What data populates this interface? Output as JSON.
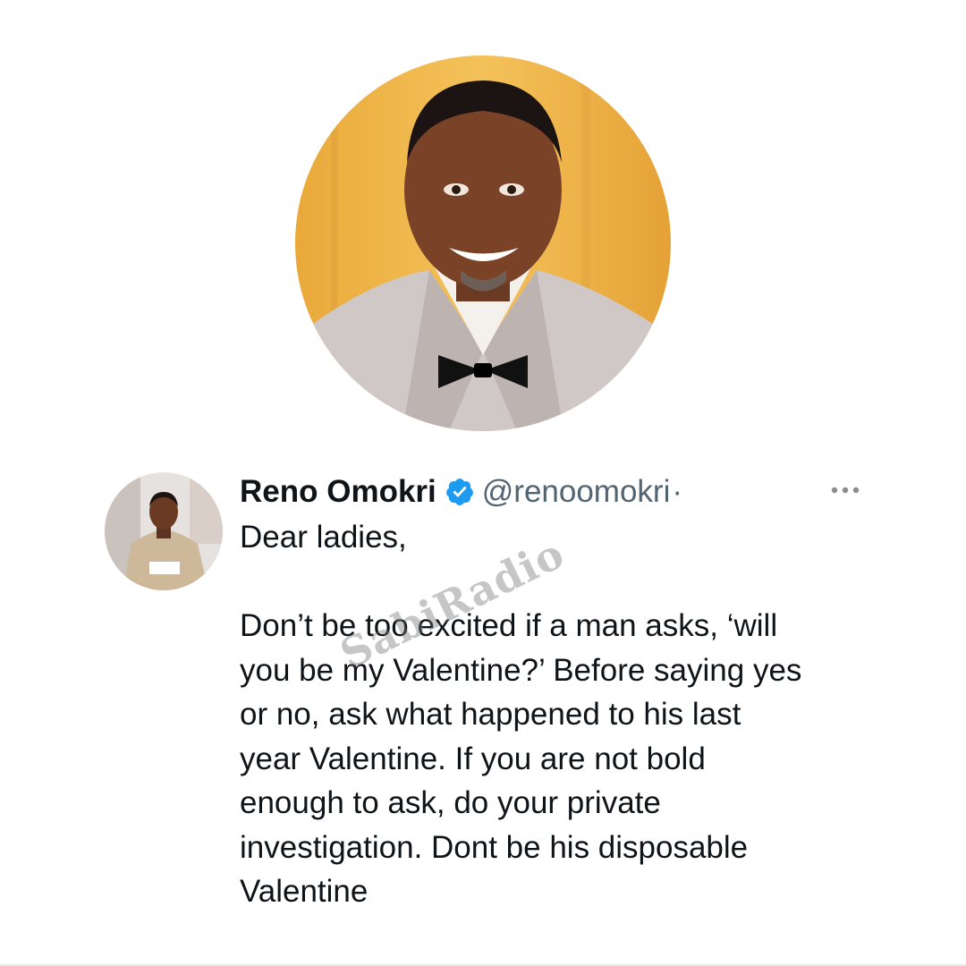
{
  "profile": {
    "photo": "man-bowtie-portrait"
  },
  "tweet": {
    "display_name": "Reno Omokri",
    "verified_icon": "verified-badge-icon",
    "handle": "@renoomokri",
    "separator": "·",
    "more_icon": "more-options-icon",
    "body": {
      "greeting": "Dear ladies,",
      "lines": [
        "Don’t be too excited if a man asks, ‘will",
        "you be my Valentine?’ Before saying yes",
        "or no, ask what happened to his last",
        "year Valentine. If you are not bold",
        "enough to ask, do your private",
        "investigation. Dont be his disposable",
        "Valentine"
      ]
    }
  },
  "watermark": "SabiRadio",
  "colors": {
    "text": "#0f1419",
    "secondary": "#536471",
    "verified": "#1d9bf0",
    "photo_background": "#f0b842"
  }
}
